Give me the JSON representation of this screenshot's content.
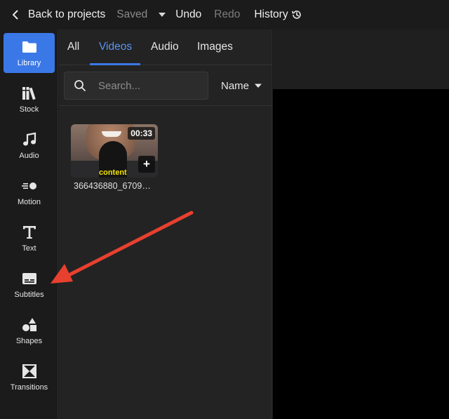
{
  "topbar": {
    "back_label": "Back to projects",
    "saved_label": "Saved",
    "undo_label": "Undo",
    "redo_label": "Redo",
    "history_label": "History"
  },
  "rail": {
    "items": [
      {
        "label": "Library",
        "icon": "folder-icon",
        "active": true
      },
      {
        "label": "Stock",
        "icon": "books-icon"
      },
      {
        "label": "Audio",
        "icon": "music-note-icon"
      },
      {
        "label": "Motion",
        "icon": "motion-icon"
      },
      {
        "label": "Text",
        "icon": "text-t-icon"
      },
      {
        "label": "Subtitles",
        "icon": "subtitles-icon"
      },
      {
        "label": "Shapes",
        "icon": "shapes-icon"
      },
      {
        "label": "Transitions",
        "icon": "transitions-icon"
      }
    ]
  },
  "library": {
    "tabs": [
      {
        "label": "All"
      },
      {
        "label": "Videos",
        "active": true
      },
      {
        "label": "Audio"
      },
      {
        "label": "Images"
      }
    ],
    "search_placeholder": "Search...",
    "sort_label": "Name",
    "clips": [
      {
        "name": "366436880_6709…",
        "duration": "00:33",
        "caption": "content",
        "add_label": "+"
      }
    ]
  },
  "colors": {
    "accent": "#3b78e7",
    "tab_active": "#5b93f5",
    "annotation_arrow": "#e8402f"
  }
}
